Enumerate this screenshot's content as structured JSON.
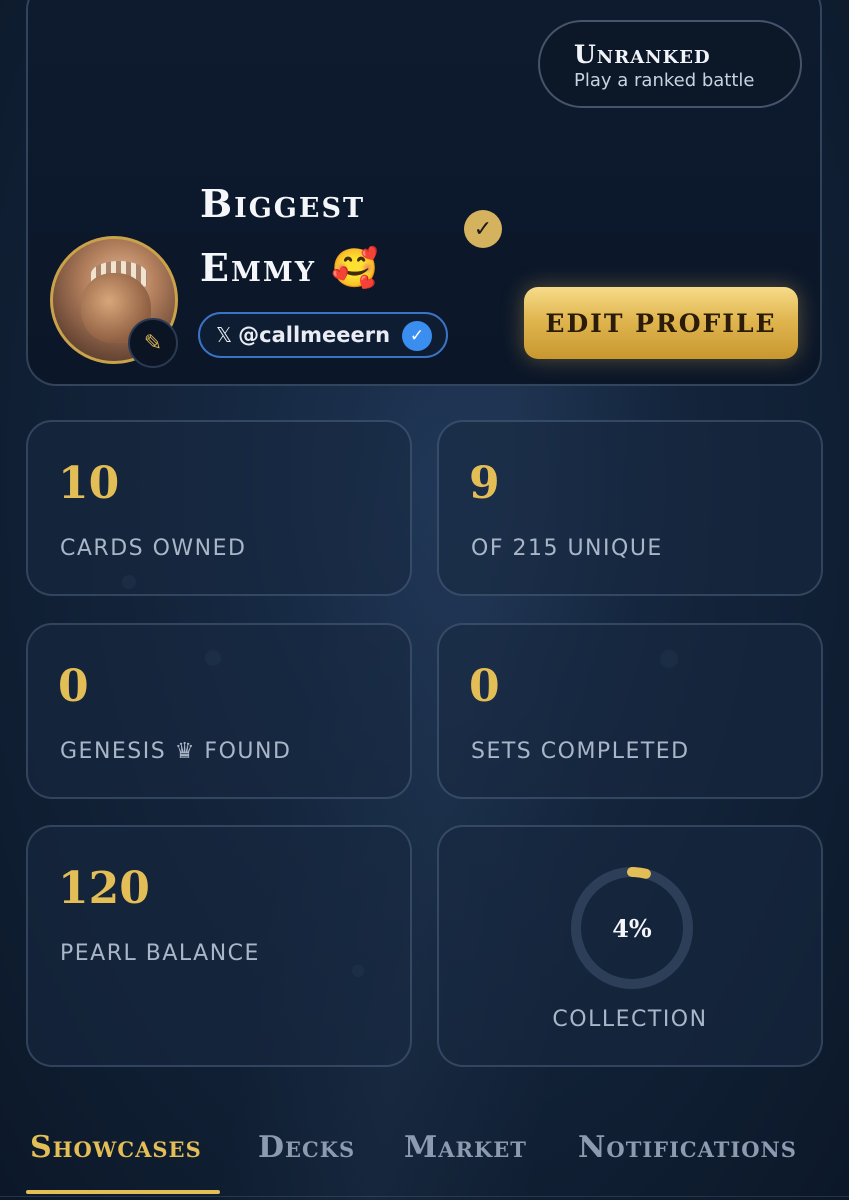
{
  "profile": {
    "rank_title": "Unranked",
    "rank_subtitle": "Play a ranked battle",
    "display_name": "Biggest Emmy 🥰",
    "handle_prefix": "𝕏",
    "handle": "@callmeeern",
    "edit_button": "EDIT PROFILE"
  },
  "stats": [
    {
      "value": "10",
      "label": "CARDS OWNED"
    },
    {
      "value": "9",
      "label": "OF 215 UNIQUE"
    },
    {
      "value": "0",
      "label": "GENESIS ♛ FOUND"
    },
    {
      "value": "0",
      "label": "SETS COMPLETED"
    },
    {
      "value": "120",
      "label": "PEARL BALANCE"
    }
  ],
  "collection": {
    "percent_text": "4%",
    "fraction": 0.04,
    "label": "COLLECTION"
  },
  "tabs": [
    {
      "label": "Showcases",
      "active": true
    },
    {
      "label": "Decks",
      "active": false
    },
    {
      "label": "Market",
      "active": false
    },
    {
      "label": "Notifications",
      "active": false
    }
  ],
  "colors": {
    "accent_gold": "#e3bd55",
    "ring_track": "#2d3f58",
    "verified_blue": "#3a8ef0"
  }
}
